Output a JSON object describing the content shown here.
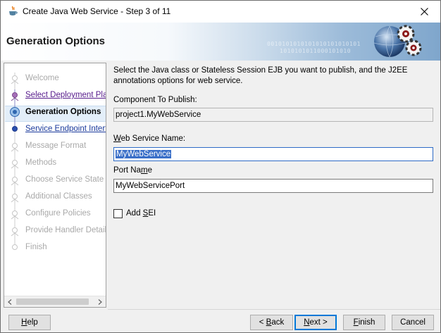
{
  "window": {
    "title": "Create Java Web Service - Step 3 of 11",
    "app_icon": "java-coffee-cup-icon",
    "close_icon": "close-icon"
  },
  "banner": {
    "title": "Generation Options",
    "art_icon": "web-service-gears-icon"
  },
  "nav": {
    "items": [
      {
        "label": "Welcome",
        "state": "disabled"
      },
      {
        "label": "Select Deployment Platform",
        "state": "visited"
      },
      {
        "label": "Generation Options",
        "state": "current"
      },
      {
        "label": "Service Endpoint Interface",
        "state": "enabled"
      },
      {
        "label": "Message Format",
        "state": "disabled"
      },
      {
        "label": "Methods",
        "state": "disabled"
      },
      {
        "label": "Choose Service State",
        "state": "disabled"
      },
      {
        "label": "Additional Classes",
        "state": "disabled"
      },
      {
        "label": "Configure Policies",
        "state": "disabled"
      },
      {
        "label": "Provide Handler Details",
        "state": "disabled"
      },
      {
        "label": "Finish",
        "state": "disabled"
      }
    ]
  },
  "form": {
    "description": "Select the Java class or Stateless Session EJB you want to publish, and the J2EE annotations options for web service.",
    "component_label": "Component To Publish:",
    "component_value": "project1.MyWebService",
    "ws_name_label_u": "W",
    "ws_name_label_rest": "eb Service Name:",
    "ws_name_value": "MyWebService",
    "port_label_a": "Port Na",
    "port_label_u": "m",
    "port_label_b": "e",
    "port_value": "MyWebServicePort",
    "add_sei_a": "Add ",
    "add_sei_u": "S",
    "add_sei_b": "EI",
    "add_sei_checked": false
  },
  "buttons": {
    "help_u": "H",
    "help_rest": "elp",
    "back_prefix": "< ",
    "back_u": "B",
    "back_rest": "ack",
    "next_u": "N",
    "next_rest": "ext >",
    "finish_u": "F",
    "finish_rest": "inish",
    "cancel": "Cancel"
  }
}
